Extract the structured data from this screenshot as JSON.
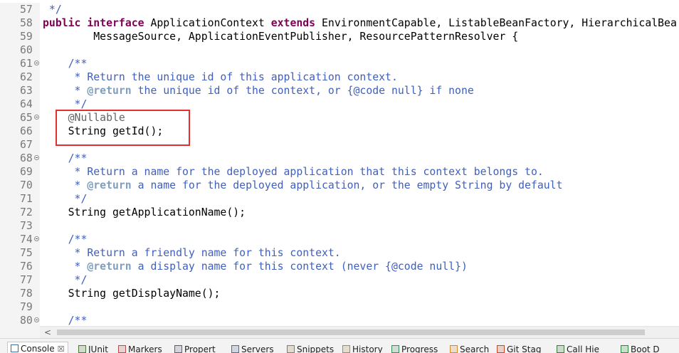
{
  "editor": {
    "lines": [
      {
        "n": "57",
        "fold": false,
        "segs": [
          {
            "t": " */",
            "c": "comment"
          }
        ]
      },
      {
        "n": "58",
        "fold": false,
        "segs": [
          {
            "t": "public",
            "c": "kw"
          },
          {
            "t": " ",
            "c": "plain"
          },
          {
            "t": "interface",
            "c": "kw"
          },
          {
            "t": " ApplicationContext ",
            "c": "plain"
          },
          {
            "t": "extends",
            "c": "kw"
          },
          {
            "t": " EnvironmentCapable, ListableBeanFactory, HierarchicalBea",
            "c": "plain"
          }
        ]
      },
      {
        "n": "59",
        "fold": false,
        "segs": [
          {
            "t": "        MessageSource, ApplicationEventPublisher, ResourcePatternResolver {",
            "c": "plain"
          }
        ]
      },
      {
        "n": "60",
        "fold": false,
        "segs": []
      },
      {
        "n": "61",
        "fold": true,
        "segs": [
          {
            "t": "    /**",
            "c": "comment"
          }
        ]
      },
      {
        "n": "62",
        "fold": false,
        "segs": [
          {
            "t": "     * Return the unique id of this application context.",
            "c": "comment"
          }
        ]
      },
      {
        "n": "63",
        "fold": false,
        "segs": [
          {
            "t": "     * ",
            "c": "comment"
          },
          {
            "t": "@return",
            "c": "tag"
          },
          {
            "t": " the unique id of the context, or {@code null} if none",
            "c": "comment"
          }
        ]
      },
      {
        "n": "64",
        "fold": false,
        "segs": [
          {
            "t": "     */",
            "c": "comment"
          }
        ]
      },
      {
        "n": "65",
        "fold": true,
        "segs": [
          {
            "t": "    @Nullable",
            "c": "ann"
          }
        ]
      },
      {
        "n": "66",
        "fold": false,
        "segs": [
          {
            "t": "    String getId();",
            "c": "plain"
          }
        ]
      },
      {
        "n": "67",
        "fold": false,
        "segs": []
      },
      {
        "n": "68",
        "fold": true,
        "segs": [
          {
            "t": "    /**",
            "c": "comment"
          }
        ]
      },
      {
        "n": "69",
        "fold": false,
        "segs": [
          {
            "t": "     * Return a name for the deployed application that this context belongs to.",
            "c": "comment"
          }
        ]
      },
      {
        "n": "70",
        "fold": false,
        "segs": [
          {
            "t": "     * ",
            "c": "comment"
          },
          {
            "t": "@return",
            "c": "tag"
          },
          {
            "t": " a name for the deployed application, or the empty String by default",
            "c": "comment"
          }
        ]
      },
      {
        "n": "71",
        "fold": false,
        "segs": [
          {
            "t": "     */",
            "c": "comment"
          }
        ]
      },
      {
        "n": "72",
        "fold": false,
        "segs": [
          {
            "t": "    String getApplicationName();",
            "c": "plain"
          }
        ]
      },
      {
        "n": "73",
        "fold": false,
        "segs": []
      },
      {
        "n": "74",
        "fold": true,
        "segs": [
          {
            "t": "    /**",
            "c": "comment"
          }
        ]
      },
      {
        "n": "75",
        "fold": false,
        "segs": [
          {
            "t": "     * Return a friendly name for this context.",
            "c": "comment"
          }
        ]
      },
      {
        "n": "76",
        "fold": false,
        "segs": [
          {
            "t": "     * ",
            "c": "comment"
          },
          {
            "t": "@return",
            "c": "tag"
          },
          {
            "t": " a display name for this context (never {@code null})",
            "c": "comment"
          }
        ]
      },
      {
        "n": "77",
        "fold": false,
        "segs": [
          {
            "t": "     */",
            "c": "comment"
          }
        ]
      },
      {
        "n": "78",
        "fold": false,
        "segs": [
          {
            "t": "    String getDisplayName();",
            "c": "plain"
          }
        ]
      },
      {
        "n": "79",
        "fold": false,
        "segs": []
      },
      {
        "n": "80",
        "fold": true,
        "segs": [
          {
            "t": "    /**",
            "c": "comment"
          }
        ]
      }
    ]
  },
  "scrollbar": {
    "left_arrow": "<"
  },
  "tabs": [
    {
      "label": "Console",
      "icon": "console-icon",
      "color": "#3a6ea5",
      "active": true,
      "close": "☒"
    },
    {
      "label": "JUnit",
      "icon": "junit-icon",
      "color": "#4c7a34",
      "active": false
    },
    {
      "label": "Markers",
      "icon": "markers-icon",
      "color": "#b84c4c",
      "active": false
    },
    {
      "label": "Propert",
      "icon": "properties-icon",
      "color": "#5a5a8a",
      "active": false
    },
    {
      "label": "Servers",
      "icon": "servers-icon",
      "color": "#4a6a9a",
      "active": false
    },
    {
      "label": "Snippets",
      "icon": "snippets-icon",
      "color": "#9a7a3a",
      "active": false
    },
    {
      "label": "History",
      "icon": "history-icon",
      "color": "#b08a3a",
      "active": false
    },
    {
      "label": "Progress",
      "icon": "progress-icon",
      "color": "#3a8a5a",
      "active": false
    },
    {
      "label": "Search",
      "icon": "search-icon",
      "color": "#d08a2a",
      "active": false
    },
    {
      "label": "Git Stag",
      "icon": "git-staging-icon",
      "color": "#c04a2a",
      "active": false
    },
    {
      "label": "Call Hie",
      "icon": "call-hierarchy-icon",
      "color": "#3a7a3a",
      "active": false
    },
    {
      "label": "Boot D",
      "icon": "boot-dashboard-icon",
      "color": "#2a8a3a",
      "active": false
    }
  ],
  "colors": {
    "highlight_box": "#e03030"
  }
}
